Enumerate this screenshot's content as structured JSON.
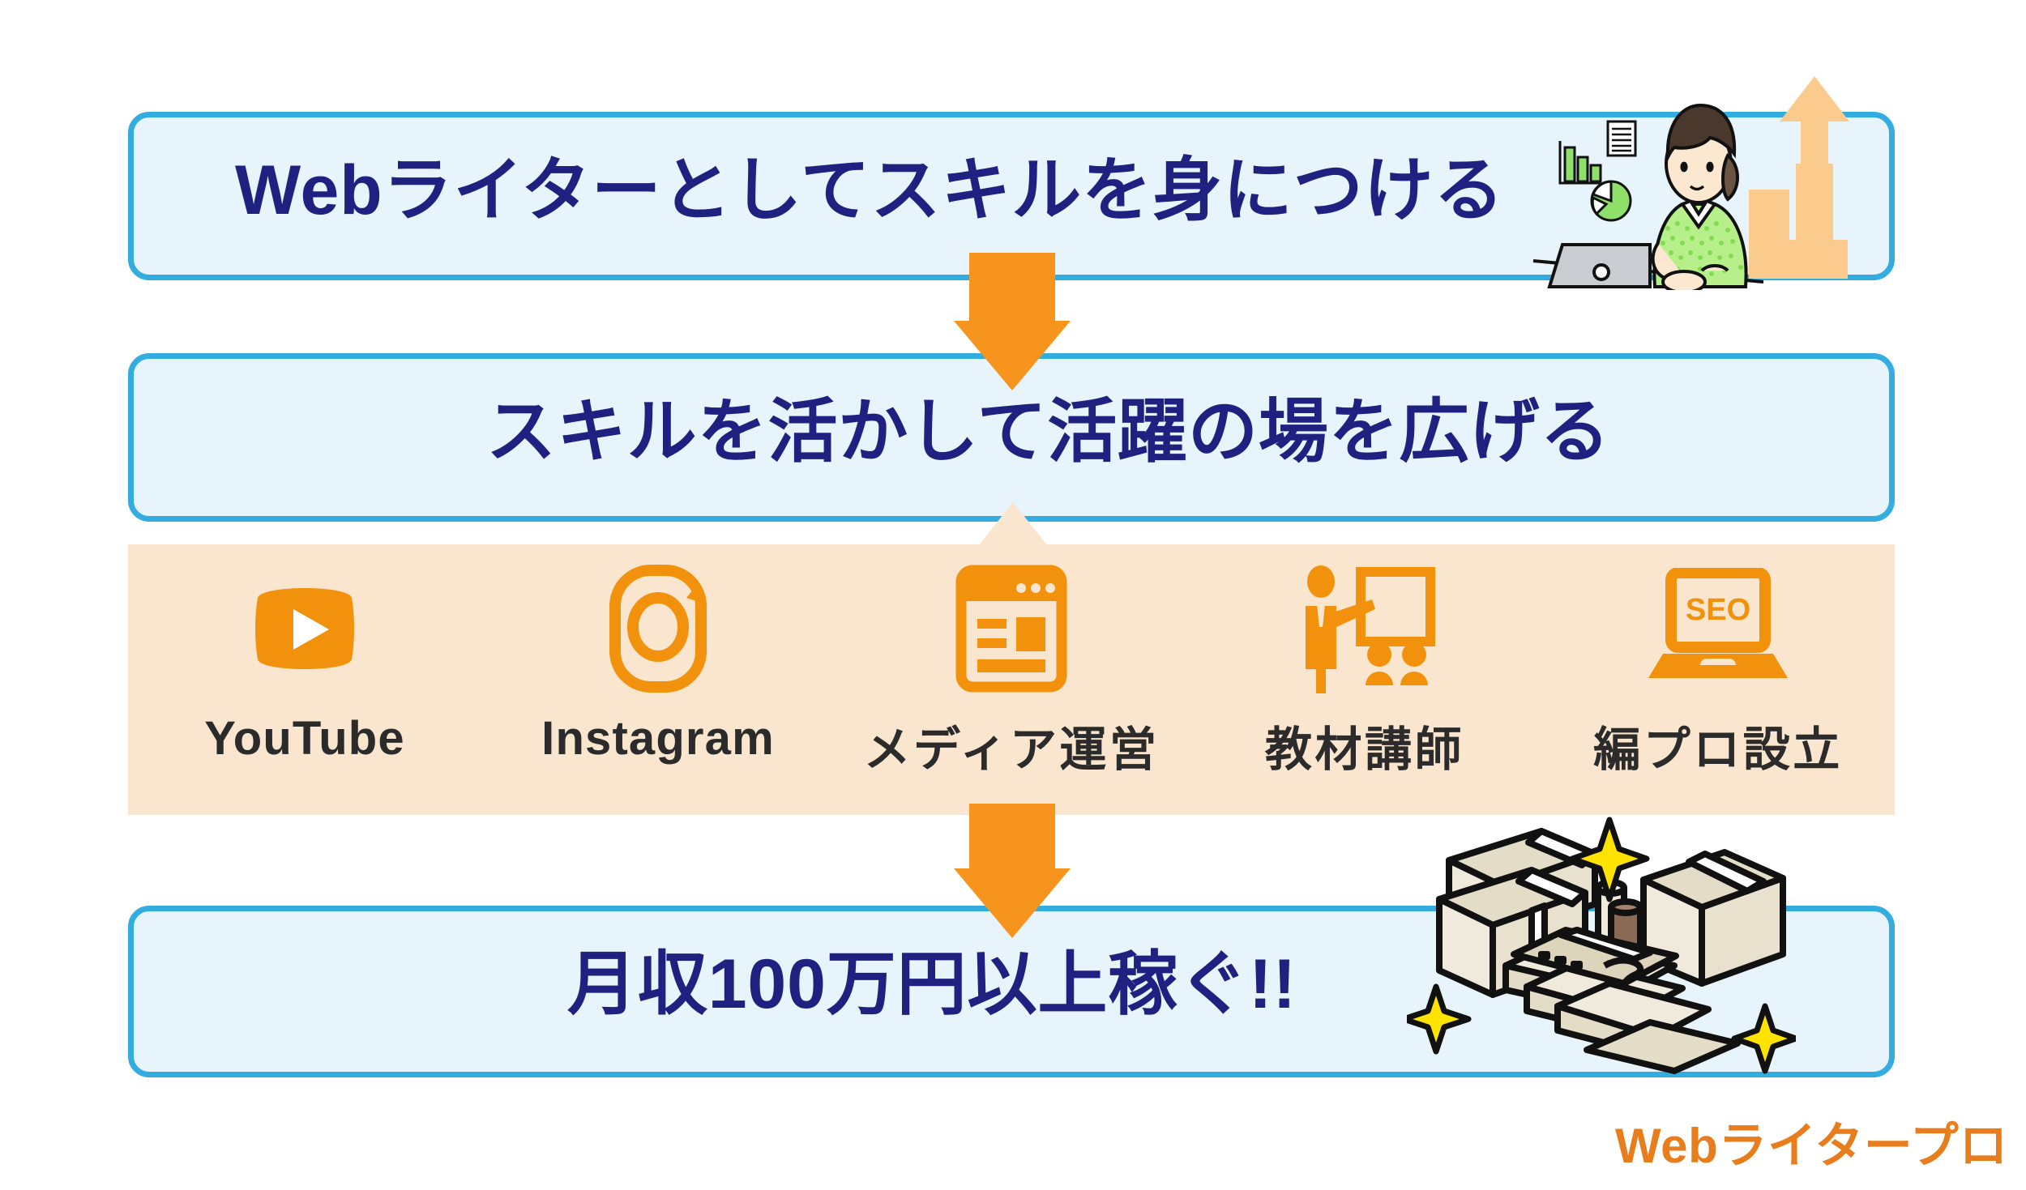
{
  "meta": {
    "title": "Webライターのキャリアステップ図",
    "colors": {
      "box_border": "#33ade0",
      "box_fill": "#e7f4fb",
      "heading_text": "#1f2180",
      "band_fill": "#fae6ce",
      "accent_orange": "#f7941d",
      "logo_orange": "#e87d1e",
      "label_text": "#2b2b2b"
    }
  },
  "steps": [
    {
      "id": "step-1",
      "text": "Webライターとしてスキルを身につける"
    },
    {
      "id": "step-2",
      "text": "スキルを活かして活躍の場を広げる"
    },
    {
      "id": "step-3",
      "text": "月収100万円以上稼ぐ!!"
    }
  ],
  "band": {
    "items": [
      {
        "label": "YouTube",
        "icon": "youtube-icon"
      },
      {
        "label": "Instagram",
        "icon": "instagram-icon"
      },
      {
        "label": "メディア運営",
        "icon": "media-window-icon"
      },
      {
        "label": "教材講師",
        "icon": "teacher-presentation-icon"
      },
      {
        "label": "編プロ設立",
        "icon": "laptop-seo-icon"
      }
    ],
    "laptop_screen_text": "SEO"
  },
  "arrows": [
    {
      "id": "arrow-1",
      "direction": "down"
    },
    {
      "id": "arrow-2",
      "direction": "down"
    }
  ],
  "illustrations": [
    {
      "id": "woman-at-laptop",
      "name": "woman-with-laptop-and-charts-illustration"
    },
    {
      "id": "cardboard-boxes",
      "name": "cardboard-boxes-with-sparkles-illustration"
    }
  ],
  "logo": {
    "text": "Webライタープロ"
  }
}
